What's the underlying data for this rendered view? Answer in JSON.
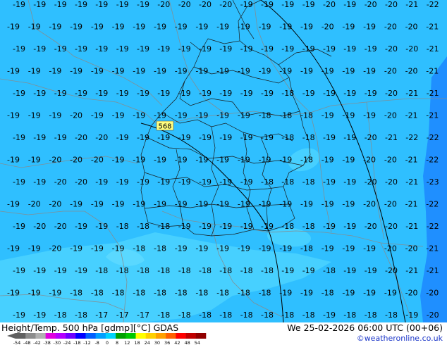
{
  "map": {
    "background_color": "#2fbfff",
    "contour_label": "568",
    "contour_label_color": "#ffff80",
    "temperature_label_rows": [
      [
        "-19",
        "-19",
        "-19",
        "-19",
        "-19",
        "-19",
        "-19",
        "-20",
        "-20",
        "-20",
        "-20",
        "-19",
        "-19",
        "-19",
        "-19",
        "-20",
        "-19",
        "-20",
        "-20",
        "-21",
        "-22"
      ],
      [
        "-19",
        "-19",
        "-19",
        "-19",
        "-19",
        "-19",
        "-19",
        "-19",
        "-19",
        "-19",
        "-19",
        "-19",
        "-19",
        "-19",
        "-19",
        "-20",
        "-19",
        "-19",
        "-20",
        "-20",
        "-21"
      ],
      [
        "-19",
        "-19",
        "-19",
        "-19",
        "-19",
        "-19",
        "-19",
        "-19",
        "-19",
        "-19",
        "-19",
        "-19",
        "-19",
        "-19",
        "-19",
        "-19",
        "-19",
        "-19",
        "-20",
        "-20",
        "-21"
      ],
      [
        "-19",
        "-19",
        "-19",
        "-19",
        "-19",
        "-19",
        "-19",
        "-19",
        "-19",
        "-19",
        "-19",
        "-19",
        "-19",
        "-19",
        "-19",
        "-19",
        "-19",
        "-19",
        "-20",
        "-20",
        "-21"
      ],
      [
        "-19",
        "-19",
        "-19",
        "-19",
        "-19",
        "-19",
        "-19",
        "-19",
        "-19",
        "-19",
        "-19",
        "-19",
        "-19",
        "-18",
        "-19",
        "-19",
        "-19",
        "-19",
        "-20",
        "-21",
        "-21"
      ],
      [
        "-19",
        "-19",
        "-19",
        "-20",
        "-19",
        "-19",
        "-19",
        "-19",
        "-19",
        "-19",
        "-19",
        "-19",
        "-18",
        "-18",
        "-18",
        "-19",
        "-19",
        "-19",
        "-20",
        "-21",
        "-21"
      ],
      [
        "-19",
        "-19",
        "-19",
        "-20",
        "-20",
        "-19",
        "-19",
        "-19",
        "-19",
        "-19",
        "-19",
        "-19",
        "-19",
        "-18",
        "-18",
        "-19",
        "-19",
        "-20",
        "-21",
        "-22",
        "-22"
      ],
      [
        "-19",
        "-19",
        "-20",
        "-20",
        "-20",
        "-19",
        "-19",
        "-19",
        "-19",
        "-19",
        "-19",
        "-19",
        "-19",
        "-19",
        "-18",
        "-19",
        "-19",
        "-20",
        "-20",
        "-21",
        "-22"
      ],
      [
        "-19",
        "-19",
        "-20",
        "-20",
        "-19",
        "-19",
        "-19",
        "-19",
        "-19",
        "-19",
        "-19",
        "-19",
        "-18",
        "-18",
        "-18",
        "-19",
        "-19",
        "-20",
        "-20",
        "-21",
        "-23"
      ],
      [
        "-19",
        "-20",
        "-20",
        "-19",
        "-19",
        "-19",
        "-19",
        "-19",
        "-19",
        "-19",
        "-19",
        "-19",
        "-19",
        "-19",
        "-19",
        "-19",
        "-19",
        "-20",
        "-20",
        "-21",
        "-22"
      ],
      [
        "-19",
        "-20",
        "-20",
        "-19",
        "-19",
        "-18",
        "-18",
        "-18",
        "-19",
        "-19",
        "-19",
        "-19",
        "-19",
        "-18",
        "-18",
        "-19",
        "-19",
        "-20",
        "-20",
        "-21",
        "-22"
      ],
      [
        "-19",
        "-19",
        "-20",
        "-19",
        "-19",
        "-19",
        "-18",
        "-18",
        "-19",
        "-19",
        "-19",
        "-19",
        "-19",
        "-19",
        "-18",
        "-19",
        "-19",
        "-19",
        "-20",
        "-20",
        "-21"
      ],
      [
        "-19",
        "-19",
        "-19",
        "-19",
        "-18",
        "-18",
        "-18",
        "-18",
        "-18",
        "-18",
        "-18",
        "-18",
        "-18",
        "-19",
        "-19",
        "-18",
        "-19",
        "-19",
        "-20",
        "-21",
        "-21"
      ],
      [
        "-19",
        "-19",
        "-19",
        "-18",
        "-18",
        "-18",
        "-18",
        "-18",
        "-18",
        "-18",
        "-18",
        "-18",
        "-18",
        "-19",
        "-19",
        "-18",
        "-19",
        "-19",
        "-19",
        "-20",
        "-20"
      ],
      [
        "-19",
        "-19",
        "-18",
        "-18",
        "-17",
        "-17",
        "-17",
        "-18",
        "-18",
        "-18",
        "-18",
        "-18",
        "-18",
        "-18",
        "-18",
        "-19",
        "-18",
        "-18",
        "-18",
        "-19",
        "-20"
      ]
    ]
  },
  "footer": {
    "title": "Height/Temp. 500 hPa [gdmp][°C] GDAS",
    "valid_time": "We 25-02-2026 06:00 UTC (00+06)",
    "credit": "©weatheronline.co.uk"
  },
  "colorbar": {
    "tick_labels": [
      "-54",
      "-48",
      "-42",
      "-38",
      "-30",
      "-24",
      "-18",
      "-12",
      "-8",
      "0",
      "8",
      "12",
      "18",
      "24",
      "30",
      "36",
      "42",
      "48",
      "54"
    ],
    "colors": [
      "#606060",
      "#8c8c8c",
      "#b0b0b0",
      "#e000e0",
      "#b400ff",
      "#6e00ff",
      "#0000ff",
      "#0060ff",
      "#00a0ff",
      "#00d4ff",
      "#00a000",
      "#00c800",
      "#ffff00",
      "#ffd000",
      "#ffa000",
      "#ff6000",
      "#ff0000",
      "#c00000",
      "#900000"
    ]
  }
}
